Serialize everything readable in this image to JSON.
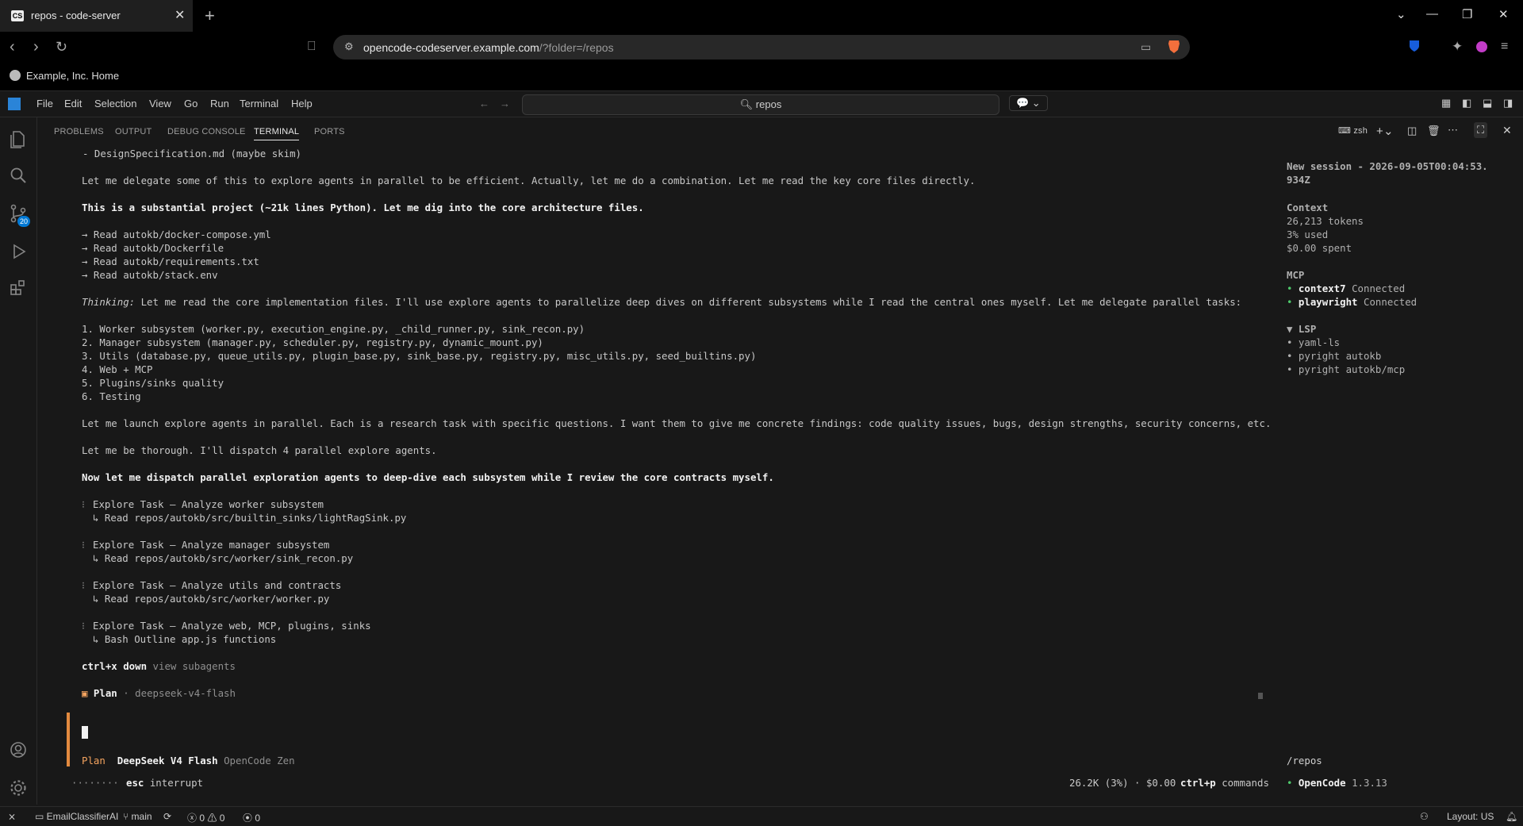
{
  "browser": {
    "tab_title": "repos - code-server",
    "tab_favicon": "CS",
    "url_host": "opencode-codeserver.example.com",
    "url_path": "/?folder=/repos",
    "bookmark": "Example, Inc. Home",
    "brand_color": "#f36f3c"
  },
  "vscode": {
    "menu": [
      "File",
      "Edit",
      "Selection",
      "View",
      "Go",
      "Run",
      "Terminal",
      "Help"
    ],
    "search_placeholder": "repos",
    "source_control_badge": "20",
    "panel_tabs": [
      "PROBLEMS",
      "OUTPUT",
      "DEBUG CONSOLE",
      "TERMINAL",
      "PORTS"
    ],
    "active_panel_tab": "TERMINAL",
    "shell": "zsh"
  },
  "terminal": {
    "lines": {
      "l1": "- DesignSpecification.md (maybe skim)",
      "l2": "Let me delegate some of this to explore agents in parallel to be efficient. Actually, let me do a combination. Let me read the key core files directly.",
      "l3": "This is a substantial project (~21k lines Python). Let me dig into the core architecture files.",
      "r1": "→ Read autokb/docker-compose.yml",
      "r2": "→ Read autokb/Dockerfile",
      "r3": "→ Read autokb/requirements.txt",
      "r4": "→ Read autokb/stack.env",
      "thinking_label": "Thinking:",
      "thinking": " Let me read the core implementation files. I'll use explore agents to parallelize deep dives on different subsystems while I read the central ones myself. Let me delegate parallel tasks:",
      "n1": "1. Worker subsystem (worker.py, execution_engine.py, _child_runner.py, sink_recon.py)",
      "n2": "2. Manager subsystem (manager.py, scheduler.py, registry.py, dynamic_mount.py)",
      "n3": "3. Utils (database.py, queue_utils.py, plugin_base.py, sink_base.py, registry.py, misc_utils.py, seed_builtins.py)",
      "n4": "4. Web + MCP",
      "n5": "5. Plugins/sinks quality",
      "n6": "6. Testing",
      "p1": "Let me launch explore agents in parallel. Each is a research task with specific questions. I want them to give me concrete findings: code quality issues, bugs, design strengths, security concerns, etc.",
      "p2": "Let me be thorough. I'll dispatch 4 parallel explore agents.",
      "p3": "Now let me dispatch parallel exploration agents to deep-dive each subsystem while I review the core contracts myself.",
      "t1": "Explore Task — Analyze worker subsystem",
      "t1s": "↳ Read repos/autokb/src/builtin_sinks/lightRagSink.py",
      "t2": "Explore Task — Analyze manager subsystem",
      "t2s": "↳ Read repos/autokb/src/worker/sink_recon.py",
      "t3": "Explore Task — Analyze utils and contracts",
      "t3s": "↳ Read repos/autokb/src/worker/worker.py",
      "t4": "Explore Task — Analyze web, MCP, plugins, sinks",
      "t4s": "↳ Bash Outline app.js functions",
      "hint_key": "ctrl+x down",
      "hint_text": " view subagents",
      "plan_label": "Plan",
      "plan_model": " · deepseek-v4-flash",
      "footer_mode": "Plan",
      "footer_model": "DeepSeek V4 Flash",
      "footer_provider": "OpenCode Zen",
      "dots": "········",
      "esc_key": "esc",
      "esc_text": " interrupt",
      "usage": "26.2K (3%) · $0.00",
      "cmd_key": "ctrl+p",
      "cmd_text": " commands"
    },
    "sidebar": {
      "session_title": "New session - 2026-09-05T00:04:53.",
      "session_title2": "934Z",
      "context_label": "Context",
      "tokens": "26,213 tokens",
      "used": "3% used",
      "spent": "$0.00 spent",
      "mcp_label": "MCP",
      "mcp1_name": "context7",
      "mcp1_status": " Connected",
      "mcp2_name": "playwright",
      "mcp2_status": " Connected",
      "lsp_label": "▼ LSP",
      "lsp1": "• yaml-ls",
      "lsp2": "• pyright autokb",
      "lsp3": "• pyright autokb/mcp",
      "cwd": "/repos",
      "version_name": "OpenCode",
      "version": " 1.3.13"
    }
  },
  "statusbar": {
    "project": "EmailClassifierAI",
    "branch": "main",
    "errors": "0",
    "warnings": "0",
    "ports": "0",
    "layout": "Layout: US"
  }
}
